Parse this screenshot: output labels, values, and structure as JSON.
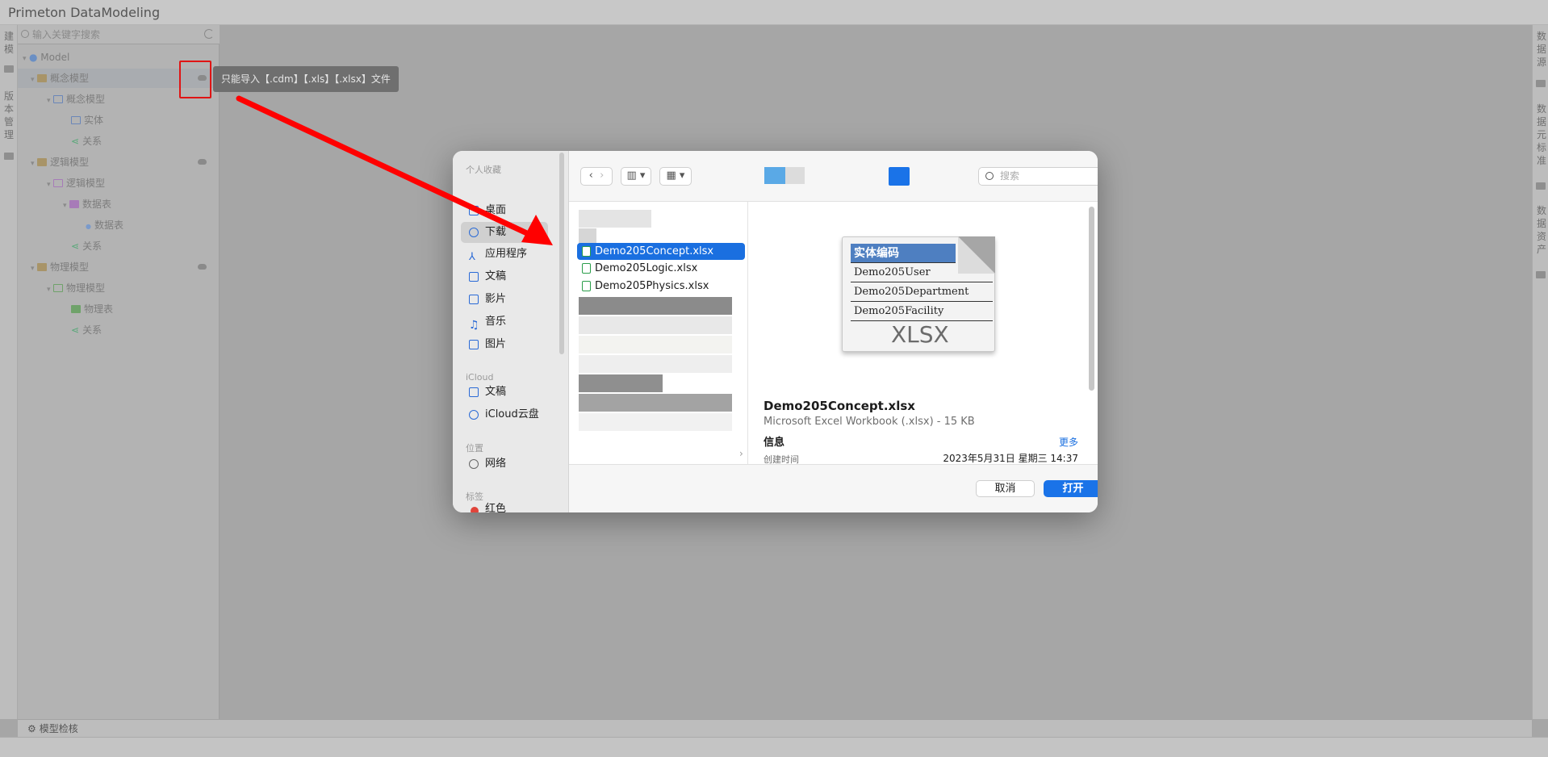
{
  "app": {
    "title": "Primeton DataModeling"
  },
  "left_rail": {
    "tab1": "建模",
    "tab2": "版本管理"
  },
  "right_rail": {
    "tab1": "数据源",
    "tab2": "数据元标准",
    "tab3": "数据资产"
  },
  "sidebar": {
    "search_placeholder": "输入关键字搜索",
    "tree": {
      "root": "Model",
      "concept_group": "概念模型",
      "concept_model": "概念模型",
      "entity": "实体",
      "concept_relation": "关系",
      "logic_group": "逻辑模型",
      "logic_model": "逻辑模型",
      "data_table_folder": "数据表",
      "data_table": "数据表",
      "logic_relation": "关系",
      "physical_group": "物理模型",
      "physical_model": "物理模型",
      "physical_table": "物理表",
      "physical_relation": "关系"
    }
  },
  "tooltip": {
    "text": "只能导入【.cdm】【.xls】【.xlsx】文件"
  },
  "bottom_bar": {
    "label": "模型检核"
  },
  "dialog": {
    "sidebar": {
      "favorites_header": "个人收藏",
      "items": [
        "桌面",
        "下载",
        "应用程序",
        "文稿",
        "影片",
        "音乐",
        "图片"
      ],
      "icloud_header": "iCloud",
      "icloud_items": [
        "文稿",
        "iCloud云盘"
      ],
      "location_header": "位置",
      "location_items": [
        "网络"
      ],
      "tags_header": "标签",
      "tags_partial": "红色"
    },
    "search_placeholder": "搜索",
    "files": [
      "Demo205Concept.xlsx",
      "Demo205Logic.xlsx",
      "Demo205Physics.xlsx"
    ],
    "preview": {
      "thumb_header": "实体编码",
      "thumb_rows": [
        "Demo205User",
        "Demo205Department",
        "Demo205Facility"
      ],
      "thumb_ext": "XLSX",
      "name": "Demo205Concept.xlsx",
      "kind": "Microsoft Excel Workbook (.xlsx) - 15 KB",
      "info_label": "信息",
      "more_label": "更多",
      "created_label": "创建时间",
      "created_value": "2023年5月31日 星期三 14:37"
    },
    "buttons": {
      "cancel": "取消",
      "open": "打开"
    }
  },
  "colors": {
    "accent": "#1a73e8",
    "annotation": "#e01414"
  }
}
